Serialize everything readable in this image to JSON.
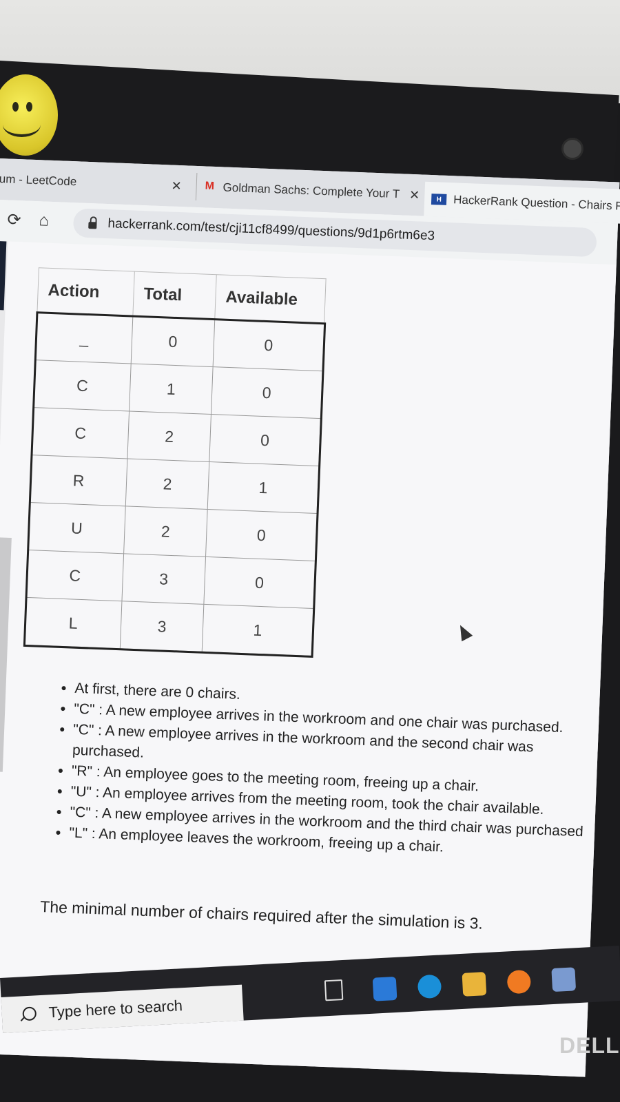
{
  "browser": {
    "tabs": [
      {
        "label": "um - LeetCode"
      },
      {
        "label": "Goldman Sachs: Complete Your T"
      },
      {
        "label": "HackerRank Question - Chairs Re"
      }
    ],
    "url": "hackerrank.com/test/cji11cf8499/questions/9d1p6rtm6e3"
  },
  "table": {
    "headers": [
      "Action",
      "Total",
      "Available"
    ],
    "rows": [
      [
        "_",
        "0",
        "0"
      ],
      [
        "C",
        "1",
        "0"
      ],
      [
        "C",
        "2",
        "0"
      ],
      [
        "R",
        "2",
        "1"
      ],
      [
        "U",
        "2",
        "0"
      ],
      [
        "C",
        "3",
        "0"
      ],
      [
        "L",
        "3",
        "1"
      ]
    ]
  },
  "notes": [
    "At first, there are 0 chairs.",
    "\"C\" : A new employee arrives in the workroom and one chair was purchased.",
    "\"C\" : A new employee arrives in the workroom and the second chair was purchased.",
    "\"R\" : An employee goes to the meeting room, freeing up a chair.",
    "\"U\" : An employee arrives from the meeting room, took the chair available.",
    "\"C\" : A new employee arrives in the workroom and the third  chair was purchased",
    "\"L\" : An employee leaves the workroom, freeing up a chair."
  ],
  "summary": "The minimal number of chairs required after the simulation is 3.",
  "taskbar": {
    "search_placeholder": "Type here to search"
  },
  "brand": "DELL"
}
